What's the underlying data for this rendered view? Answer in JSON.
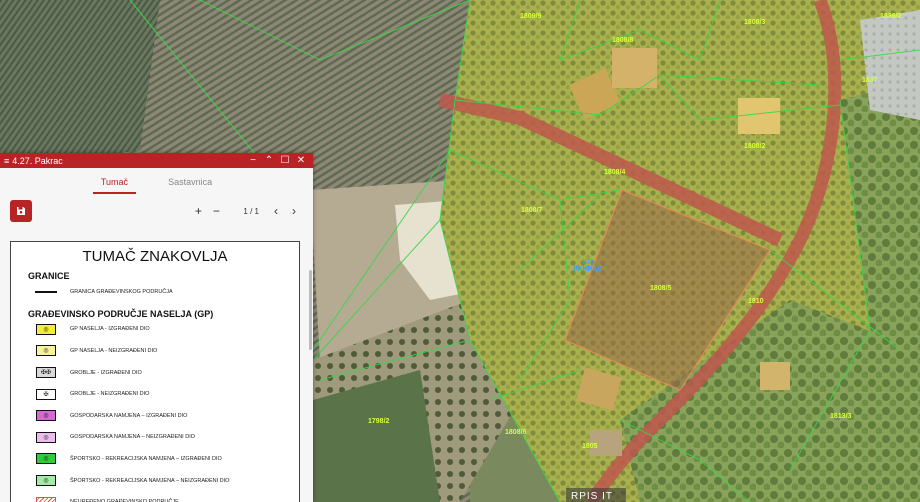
{
  "map": {
    "parcels": [
      "1809/9",
      "1808/8",
      "1808/3",
      "1836/2",
      "1837",
      "1808/2",
      "1808/4",
      "1808/7",
      "1808/5",
      "1810",
      "1798/2",
      "1808/6",
      "1805",
      "1813/3"
    ],
    "cadastre_label": [
      "KO",
      "PAKRAC"
    ],
    "watermark": "RPIS IT"
  },
  "panel": {
    "menu_icon": "≡",
    "title": "4.27. Pakrac",
    "buttons": {
      "minimize": "−",
      "collapse": "⌃",
      "maximize": "☐",
      "close": "✕"
    },
    "tabs": [
      "Tumač",
      "Sastavnica"
    ],
    "zoom_in": "+",
    "zoom_out": "−",
    "page_indicator": "1 / 1",
    "prev": "‹",
    "next": "›"
  },
  "legend": {
    "title": "TUMAČ ZNAKOVLJA",
    "sections": [
      {
        "heading": "GRANICE",
        "items": [
          {
            "label": "GRANICA GRAĐEVINSKOG PODRUČJA",
            "fill": "none",
            "mark": ""
          }
        ]
      },
      {
        "heading": "GRAĐEVINSKO PODRUČJE NASELJA (GP)",
        "items": [
          {
            "label": "GP NASELJA - IZGRAĐENI DIO",
            "fill": "#f3ee3a",
            "mark": "◎"
          },
          {
            "label": "GP NASELJA - NEIZGRAĐENI DIO",
            "fill": "#f7f39a",
            "mark": "◎"
          },
          {
            "label": "GROBLJE - IZGRAĐENI DIO",
            "fill": "#d9d9d9",
            "mark": "✠✠"
          },
          {
            "label": "GROBLJE - NEIZGRAĐENI DIO",
            "fill": "#ffffff",
            "mark": "✠"
          },
          {
            "label": "GOSPODARSKA NAMJENA – IZGRAĐENI DIO",
            "fill": "#d36bd3",
            "mark": "◎"
          },
          {
            "label": "GOSPODARSKA NAMJENA – NEIZGRAĐENI DIO",
            "fill": "#ecbdec",
            "mark": "◎"
          },
          {
            "label": "ŠPORTSKO - REKREACIJSKA NAMJENA – IZGRAĐENI DIO",
            "fill": "#2fcc3a",
            "mark": "◎"
          },
          {
            "label": "ŠPORTSKO - REKREACIJSKA NAMJENA – NEIZGRAĐENI DIO",
            "fill": "#a6eaa7",
            "mark": "◎"
          },
          {
            "label": "NEUREĐENO GRAĐEVINSKO PODRUČJE",
            "fill": "hatch",
            "mark": ""
          }
        ]
      }
    ]
  },
  "colors": {
    "accent": "#b82326",
    "parcel_line": "#37d64a",
    "parcel_label": "#d8ff3c",
    "road": "#c0584e"
  }
}
